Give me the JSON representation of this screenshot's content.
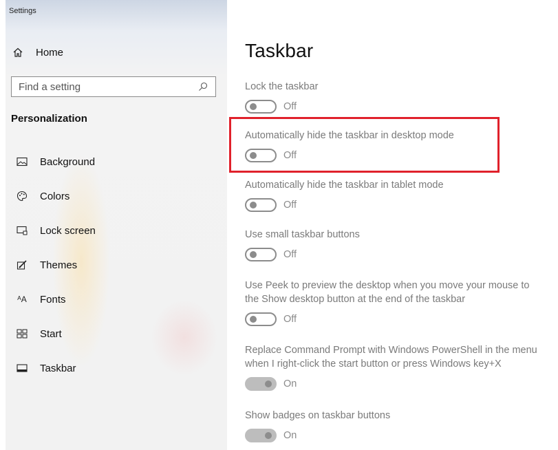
{
  "window": {
    "title": "Settings"
  },
  "sidebar": {
    "home_label": "Home",
    "search_placeholder": "Find a setting",
    "section_title": "Personalization",
    "items": [
      {
        "label": "Background",
        "icon": "picture-icon"
      },
      {
        "label": "Colors",
        "icon": "palette-icon"
      },
      {
        "label": "Lock screen",
        "icon": "lock-screen-icon"
      },
      {
        "label": "Themes",
        "icon": "themes-brush-icon"
      },
      {
        "label": "Fonts",
        "icon": "fonts-icon"
      },
      {
        "label": "Start",
        "icon": "start-grid-icon"
      },
      {
        "label": "Taskbar",
        "icon": "taskbar-icon"
      }
    ],
    "fonts_glyph": "ᴬA"
  },
  "main": {
    "title": "Taskbar",
    "settings": [
      {
        "label": "Lock the taskbar",
        "state": "Off",
        "on": false
      },
      {
        "label": "Automatically hide the taskbar in desktop mode",
        "state": "Off",
        "on": false,
        "highlighted": true
      },
      {
        "label": "Automatically hide the taskbar in tablet mode",
        "state": "Off",
        "on": false
      },
      {
        "label": "Use small taskbar buttons",
        "state": "Off",
        "on": false
      },
      {
        "label_line1": "Use Peek to preview the desktop when you move your mouse to",
        "label_line2": "the Show desktop button at the end of the taskbar",
        "state": "Off",
        "on": false
      },
      {
        "label_line1": "Replace Command Prompt with Windows PowerShell in the menu",
        "label_line2": "when I right-click the start button or press Windows key+X",
        "state": "On",
        "on": true
      },
      {
        "label": "Show badges on taskbar buttons",
        "state": "On",
        "on": true
      }
    ]
  },
  "colors": {
    "highlight_border": "#e0212b",
    "toggle_off": "#8c8c8c",
    "toggle_on_disabled": "#bdbdbd"
  }
}
